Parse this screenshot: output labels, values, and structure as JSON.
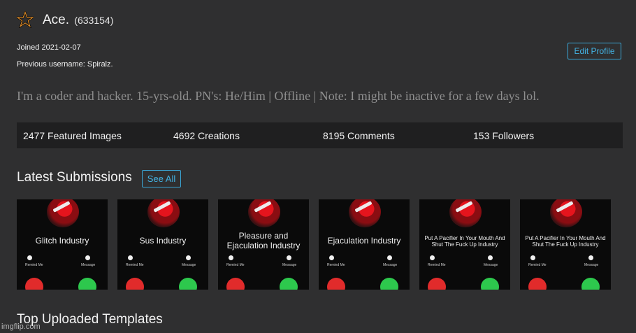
{
  "profile": {
    "username": "Ace.",
    "user_id": "(633154)",
    "joined": "Joined 2021-02-07",
    "previous_username": "Previous username: Spiralz.",
    "edit_button": "Edit Profile",
    "bio": "I'm a coder and hacker. 15-yrs-old. PN's: He/Him | Offline | Note: I might be inactive for a few days lol.",
    "icon": "star-icon",
    "colors": {
      "accent": "#43b2e3",
      "background": "#2f2f30",
      "stats_bg": "#1f1f20",
      "bio_text": "#8f8f8f"
    }
  },
  "stats": [
    {
      "label": "2477 Featured Images"
    },
    {
      "label": "4692 Creations"
    },
    {
      "label": "8195 Comments"
    },
    {
      "label": "153 Followers"
    }
  ],
  "latest": {
    "title": "Latest Submissions",
    "see_all": "See All",
    "items": [
      {
        "caption": "Glitch Industry"
      },
      {
        "caption": "Sus Industry"
      },
      {
        "caption": "Pleasure and Ejaculation Industry"
      },
      {
        "caption": "Ejaculation Industry"
      },
      {
        "caption": "Put A Pacifier In Your Mouth And Shut The Fuck Up Industry"
      },
      {
        "caption": "Put A Pacifier In Your Mouth And Shut The Fuck Up Industry"
      }
    ],
    "thumb_labels": {
      "remind": "Remind Me",
      "message": "Message"
    }
  },
  "top_templates": {
    "title": "Top Uploaded Templates"
  },
  "watermark": "imgflip.com"
}
